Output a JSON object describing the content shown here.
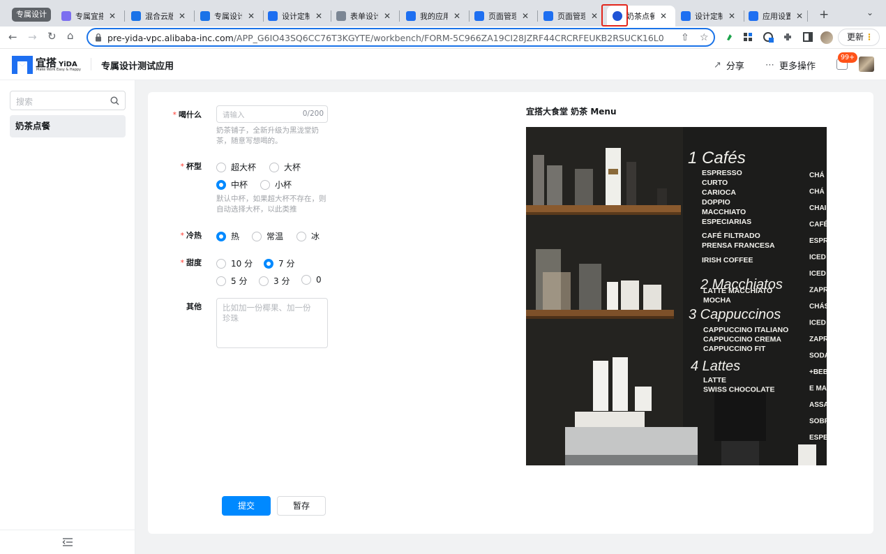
{
  "browser": {
    "group_label": "专属设计",
    "tabs": [
      {
        "label": "专属宜搭",
        "icon": "form-purple-icon",
        "color": "#7c6ff0"
      },
      {
        "label": "混合云版",
        "icon": "doc-blue-icon",
        "color": "#1a73e8"
      },
      {
        "label": "专属设计",
        "icon": "doc-blue-icon",
        "color": "#1a73e8"
      },
      {
        "label": "设计定制",
        "icon": "yida-icon",
        "color": "#1e6ff1"
      },
      {
        "label": "表单设计",
        "icon": "form-designer-icon",
        "color": "#7b8694"
      },
      {
        "label": "我的应用",
        "icon": "yida-icon",
        "color": "#1e6ff1"
      },
      {
        "label": "页面管理",
        "icon": "yida-icon",
        "color": "#1e6ff1"
      },
      {
        "label": "页面管理",
        "icon": "yida-icon",
        "color": "#1e6ff1"
      },
      {
        "label": "奶茶点餐",
        "icon": "app-shield-icon",
        "color": "#1f54d6"
      },
      {
        "label": "设计定制",
        "icon": "yida-icon",
        "color": "#1e6ff1"
      },
      {
        "label": "应用设置",
        "icon": "yida-icon",
        "color": "#1e6ff1"
      }
    ],
    "url_domain": "pre-yida-vpc.alibaba-inc.com",
    "url_path": "/APP_G6IO43SQ6CC76T3KGYTE/workbench/FORM-5C966ZA19CI28JZRF44CRCRFEUKB2RSUCK16L0",
    "update_label": "更新"
  },
  "header": {
    "logo_text": "宜搭",
    "logo_sub": "YiDA",
    "logo_tagline": "Make Work Easy & Happy",
    "app_title": "专属设计测试应用",
    "share_label": "分享",
    "more_label": "更多操作",
    "badge": "99+"
  },
  "sidebar": {
    "search_placeholder": "搜索",
    "items": [
      {
        "label": "奶茶点餐"
      }
    ]
  },
  "form": {
    "drink": {
      "label": "喝什么",
      "placeholder": "请输入",
      "counter": "0/200",
      "hint_lines": [
        "奶茶铺子，全新升级为黑泷堂奶",
        "茶，随意写想喝的。"
      ]
    },
    "cup": {
      "label": "杯型",
      "options": [
        "超大杯",
        "大杯",
        "中杯",
        "小杯"
      ],
      "selected": "中杯",
      "hint_lines": [
        "默认中杯，如果超大杯不存在，则",
        "自动选择大杯，以此类推"
      ]
    },
    "temp": {
      "label": "冷热",
      "options": [
        "热",
        "常温",
        "冰"
      ],
      "selected": "热"
    },
    "sweet": {
      "label": "甜度",
      "options": [
        "10 分",
        "7 分",
        "5 分",
        "3 分",
        "0"
      ],
      "selected": "7 分"
    },
    "other": {
      "label": "其他",
      "placeholder_lines": [
        "比如加一份椰果、加一份",
        "珍珠"
      ]
    },
    "submit_label": "提交",
    "save_label": "暂存"
  },
  "menu": {
    "title": "宜搭大食堂 奶茶 Menu",
    "board": {
      "sec1": "1 Cafés",
      "sec1_items": [
        "ESPRESSO",
        "CURTO",
        "CARIOCA",
        "DOPPIO",
        "MACCHIATO",
        "ESPECIARIAS"
      ],
      "sec1b_items": [
        "CAFÉ FILTRADO",
        "PRENSA FRANCESA"
      ],
      "sec1c_items": [
        "IRISH COFFEE"
      ],
      "sec2": "2 Macchiatos",
      "sec2_items": [
        "LATTE MACCHIATO",
        "MOCHA"
      ],
      "sec3": "3 Cappuccinos",
      "sec3_items": [
        "CAPPUCCINO ITALIANO",
        "CAPPUCCINO CREMA",
        "CAPPUCCINO FIT"
      ],
      "sec4": "4 Lattes",
      "sec4_items": [
        "LATTE",
        "SWISS CHOCOLATE"
      ],
      "right_col": [
        "CHÁ",
        "CHÁ",
        "CHAI",
        "CAFÉ",
        "ESPR",
        "ICED",
        "ICED",
        "ZAPR",
        "CHÁS",
        "ICED",
        "ZAPR",
        "SODA",
        "+BEB",
        "E MA",
        "ASSA",
        "SOBR",
        "ESPE"
      ]
    }
  }
}
